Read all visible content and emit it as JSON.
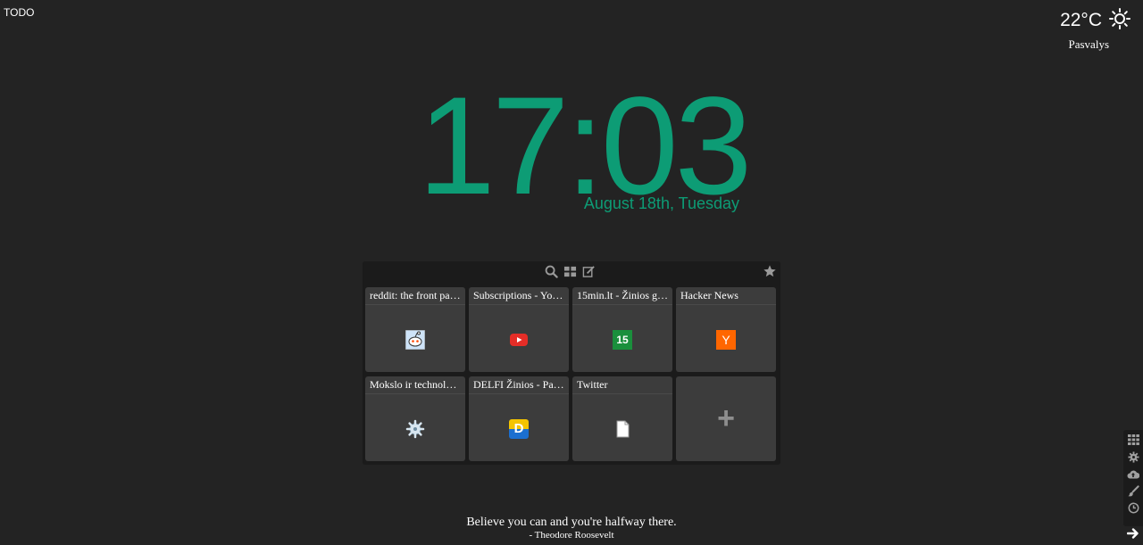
{
  "todo_label": "TODO",
  "weather": {
    "temp": "22°C",
    "city": "Pasvalys",
    "icon": "sun-icon"
  },
  "clock": {
    "time": "17:03",
    "date": "August 18th, Tuesday"
  },
  "toolbar": {
    "icons": [
      "search-icon",
      "grid-icon",
      "edit-icon",
      "star-icon"
    ]
  },
  "tiles": [
    {
      "title": "reddit: the front pag…",
      "icon": "reddit-icon"
    },
    {
      "title": "Subscriptions - You…",
      "icon": "youtube-icon"
    },
    {
      "title": "15min.lt - Žinios gy…",
      "icon": "15min-icon",
      "icon_text": "15"
    },
    {
      "title": "Hacker News",
      "icon": "hacker-news-icon",
      "icon_text": "Y"
    },
    {
      "title": "Mokslo ir technolog…",
      "icon": "gear-icon"
    },
    {
      "title": "DELFI Žinios - Pag…",
      "icon": "delfi-icon",
      "icon_text": "D"
    },
    {
      "title": "Twitter",
      "icon": "document-icon"
    }
  ],
  "add_tile": {
    "label": "+"
  },
  "quote": {
    "text": "Believe you can and you're halfway there.",
    "author": "- Theodore Roosevelt"
  },
  "sidebar": {
    "icons": [
      "grid-icon",
      "settings-icon",
      "cloud-upload-icon",
      "brush-icon",
      "clock-icon"
    ]
  },
  "colors": {
    "background": "#232323",
    "accent": "#0d9c75",
    "tile": "#3c3c3c",
    "panel": "#1b1b1b"
  }
}
